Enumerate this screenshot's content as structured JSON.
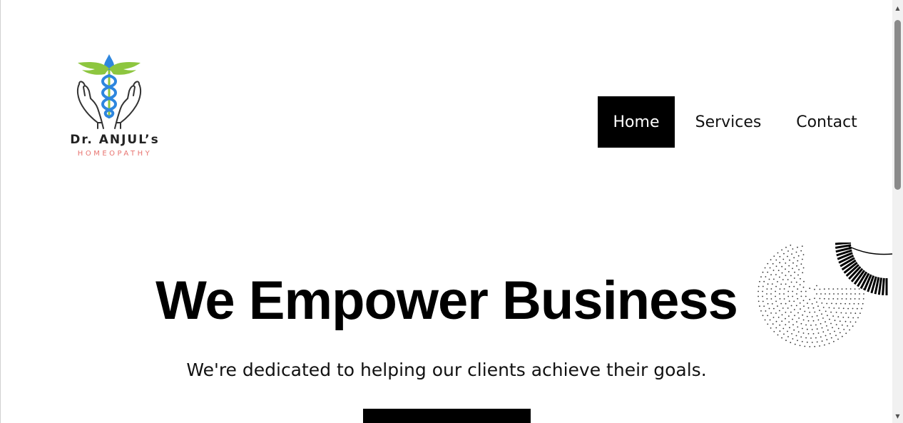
{
  "logo": {
    "title": "Dr. ANJUL’s",
    "subtitle": "HOMEOPATHY",
    "icon": "caduceus-hands-icon",
    "colors": {
      "wings": "#8dc63f",
      "staff": "#2e86de",
      "hands": "#333333",
      "subtitle": "#e8736f"
    }
  },
  "nav": {
    "items": [
      {
        "label": "Home",
        "active": true
      },
      {
        "label": "Services",
        "active": false
      },
      {
        "label": "Contact",
        "active": false
      }
    ],
    "active_bg": "#000000"
  },
  "hero": {
    "title": "We Empower Business",
    "subtitle": "We're dedicated to helping our clients achieve their goals.",
    "cta_label": ""
  },
  "scrollbar": {
    "up_icon": "▲",
    "down_icon": "▼"
  }
}
